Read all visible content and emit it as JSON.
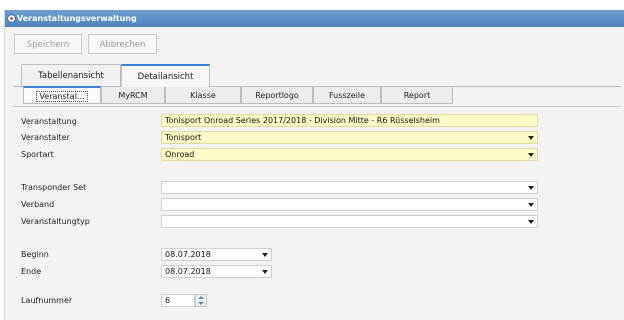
{
  "window": {
    "title": "Veranstaltungsverwaltung"
  },
  "toolbar": {
    "save_label": "Speichern",
    "cancel_label": "Abbrechen"
  },
  "view_tabs": [
    {
      "label": "Tabellenansicht",
      "active": false
    },
    {
      "label": "Detailansicht",
      "active": true
    }
  ],
  "detail_tabs": [
    {
      "label": "Veranstal...",
      "active": true
    },
    {
      "label": "MyRCM",
      "active": false
    },
    {
      "label": "Klasse",
      "active": false
    },
    {
      "label": "Reportlogo",
      "active": false
    },
    {
      "label": "Fusszeile",
      "active": false
    },
    {
      "label": "Report",
      "active": false
    }
  ],
  "form": {
    "veranstaltung": {
      "label": "Veranstaltung",
      "value": "Tonisport Onroad Series 2017/2018 - Division Mitte - R6 Rüsselsheim"
    },
    "veranstalter": {
      "label": "Veranstalter",
      "value": "Tonisport"
    },
    "sportart": {
      "label": "Sportart",
      "value": "Onroad"
    },
    "transponder_set": {
      "label": "Transponder Set",
      "value": ""
    },
    "verband": {
      "label": "Verband",
      "value": ""
    },
    "veranstaltungtyp": {
      "label": "Veranstaltungtyp",
      "value": ""
    },
    "beginn": {
      "label": "Beginn",
      "value": "08.07.2018"
    },
    "ende": {
      "label": "Ende",
      "value": "08.07.2018"
    },
    "laufnummer": {
      "label": "Laufnummer",
      "value": "6"
    }
  },
  "colors": {
    "titlebar": "#5a8cc6",
    "accent": "#3a82d8",
    "highlight_field": "#fffbc8"
  }
}
